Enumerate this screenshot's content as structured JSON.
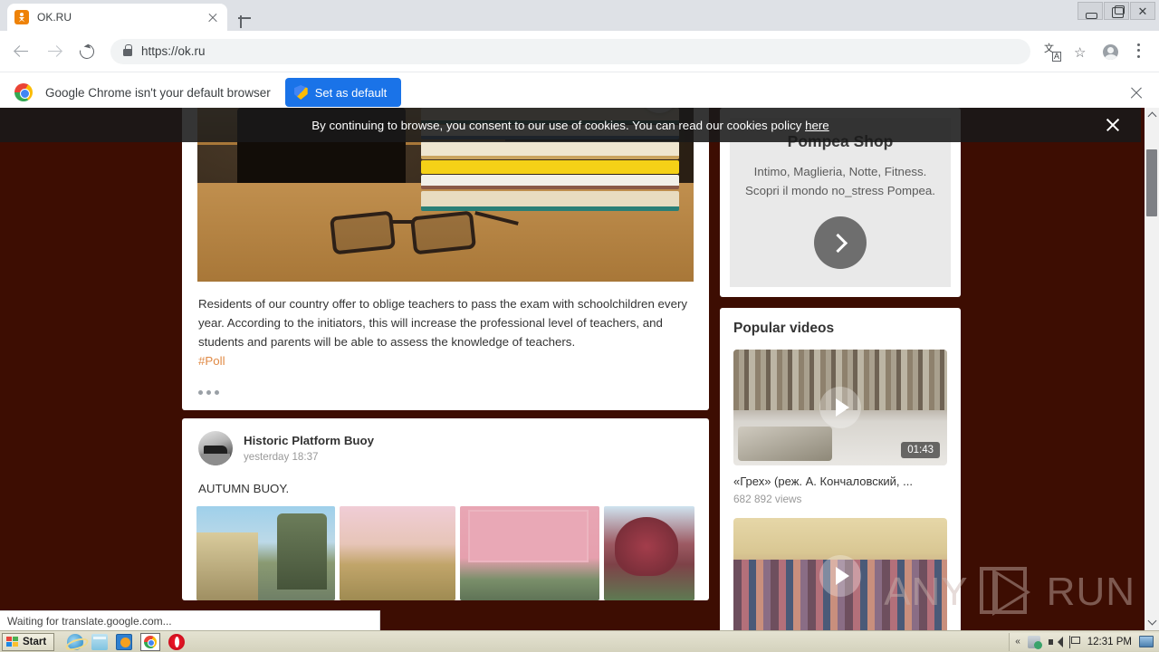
{
  "browser": {
    "tab": {
      "title": "OK.RU",
      "favicon": "ok-favicon-icon",
      "close": "close-tab-icon"
    },
    "new_tab_label": "+",
    "window_controls": {
      "minimize": "minimize-icon",
      "maximize": "maximize-icon",
      "close": "close-icon"
    },
    "nav": {
      "back": "back-arrow-icon",
      "forward": "forward-arrow-icon",
      "reload": "reload-icon"
    },
    "omnibox": {
      "url": "https://ok.ru",
      "lock": "lock-icon"
    },
    "toolbar_icons": {
      "translate": "translate-icon",
      "bookmark": "star-icon",
      "profile": "avatar-icon",
      "menu": "kebab-menu-icon"
    },
    "notification": {
      "message": "Google Chrome isn't your default browser",
      "button": "Set as default",
      "close": "close-icon"
    },
    "status": "Waiting for translate.google.com..."
  },
  "cookie_banner": {
    "text_before": "By continuing to browse, you consent to our use of cookies. You can read our cookies policy ",
    "link": "here",
    "close": "close-icon"
  },
  "feed": {
    "scroll_top": "chevron-up-icon",
    "post1": {
      "image": "books-and-glasses-photo",
      "text": "Residents of our country offer to oblige teachers to pass the exam with schoolchildren every year. According to the initiators, this will increase the professional level of teachers, and students and parents will be able to assess the knowledge of teachers. ",
      "hashtag": "#Poll",
      "more": "more-options-icon"
    },
    "post2": {
      "author": "Historic Platform Buoy",
      "time": "yesterday 18:37",
      "avatar": "author-avatar",
      "text": "AUTUMN BUOY.",
      "thumbnails": [
        "street-with-trees-photo",
        "building-behind-trees-photo",
        "pink-apartment-block-photo",
        "red-autumn-tree-photo"
      ]
    }
  },
  "rail": {
    "ad": {
      "title": "Pompea Shop",
      "body": "Intimo, Maglieria, Notte, Fitness. Scopri il mondo no_stress Pompea.",
      "cta": "chevron-right-icon"
    },
    "videos": {
      "heading": "Popular videos",
      "items": [
        {
          "thumbnail": "winter-crowd-film-still",
          "duration": "01:43",
          "title": "«Грех» (реж. А. Кончаловский, ...",
          "views": "682 892 views",
          "play": "play-icon"
        },
        {
          "thumbnail": "crowded-hall-photo",
          "play": "play-icon"
        }
      ]
    }
  },
  "watermark": {
    "left": "ANY",
    "right": "RUN"
  },
  "scrollbar": {
    "up": "scroll-up-arrow-icon",
    "down": "scroll-down-arrow-icon",
    "thumb": "scrollbar-thumb"
  },
  "taskbar": {
    "start": "Start",
    "quick_launch": [
      "internet-explorer-icon",
      "folder-icon",
      "media-player-icon",
      "chrome-icon",
      "opera-icon"
    ],
    "tray": {
      "chevron": "«",
      "icons": [
        "network-icon",
        "volume-icon",
        "keyboard-language-icon"
      ],
      "clock": "12:31 PM",
      "show_desktop": "show-desktop-icon"
    }
  },
  "colors": {
    "accent": "#1a73e8",
    "page_bg": "#3d0d02",
    "hashtag": "#e08a45"
  }
}
